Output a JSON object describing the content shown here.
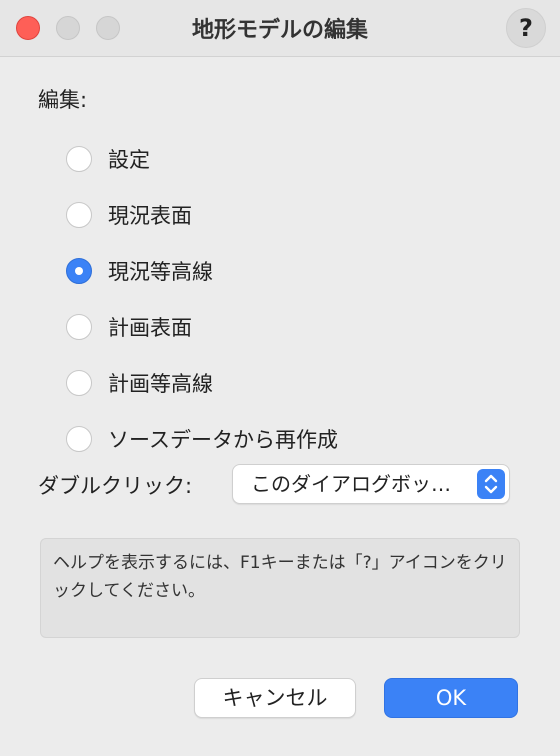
{
  "window": {
    "title": "地形モデルの編集",
    "help_button_label": "?"
  },
  "edit": {
    "label": "編集:",
    "options": [
      {
        "label": "設定",
        "selected": false
      },
      {
        "label": "現況表面",
        "selected": false
      },
      {
        "label": "現況等高線",
        "selected": true
      },
      {
        "label": "計画表面",
        "selected": false
      },
      {
        "label": "計画等高線",
        "selected": false
      },
      {
        "label": "ソースデータから再作成",
        "selected": false
      }
    ]
  },
  "double_click": {
    "label": "ダブルクリック:",
    "selected_value": "このダイアログボッ…"
  },
  "help_text": "ヘルプを表示するには、F1キーまたは「?」アイコンをクリックしてください。",
  "buttons": {
    "cancel_label": "キャンセル",
    "ok_label": "OK"
  },
  "colors": {
    "accent": "#3b82f6",
    "close_button": "#fe5f57"
  },
  "icons": [
    "close-icon",
    "minimize-icon",
    "maximize-icon",
    "help-icon",
    "stepper-chevrons-icon"
  ]
}
